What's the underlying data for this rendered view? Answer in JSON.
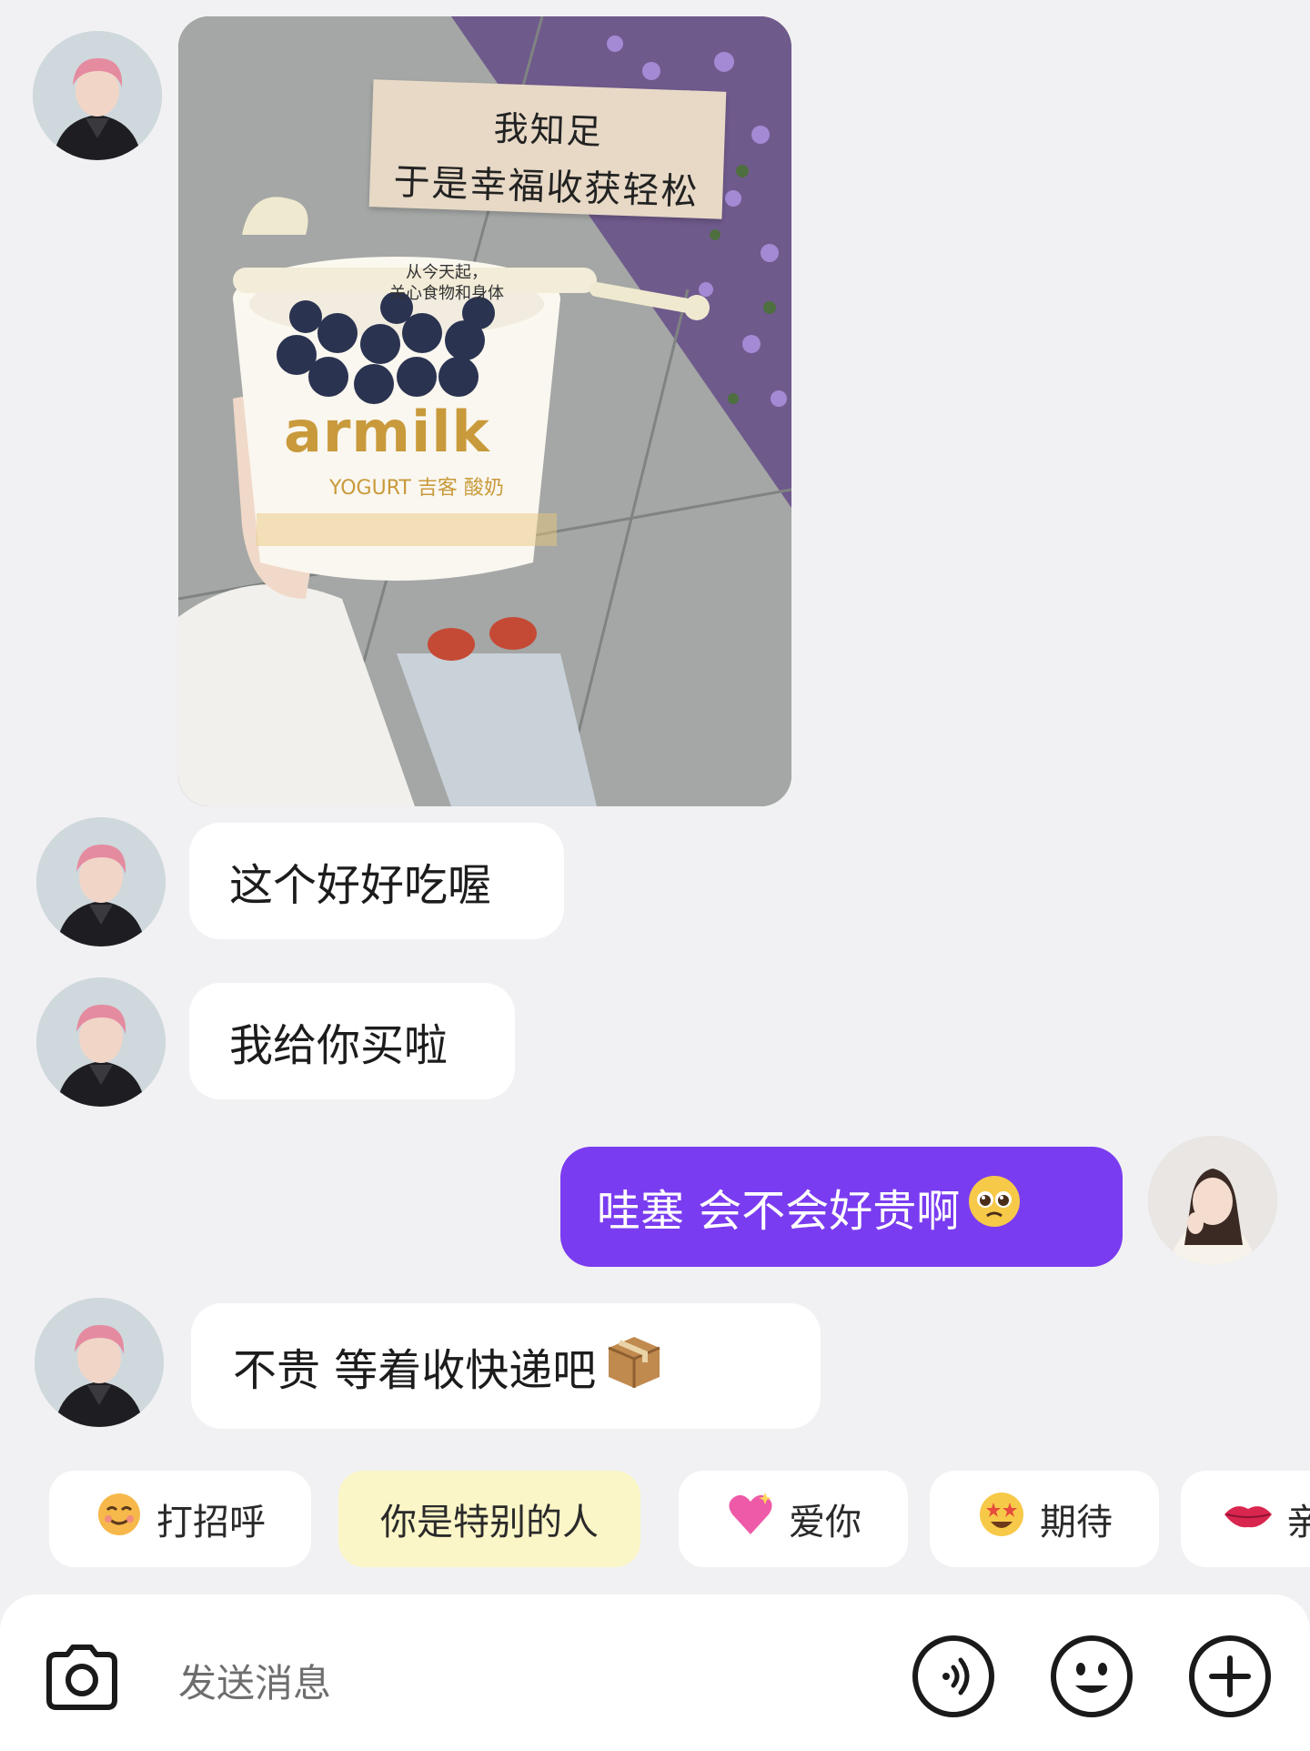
{
  "image_message": {
    "note_line1": "我知足",
    "note_line2": "于是幸福收获轻松",
    "spoon_line1": "从今天起，",
    "spoon_line2": "关心食物和身体",
    "brand": "armilk",
    "brand_sub": "YOGURT 吉客 酸奶"
  },
  "messages": [
    {
      "side": "other",
      "text": "这个好好吃喔"
    },
    {
      "side": "other",
      "text": "我给你买啦"
    },
    {
      "side": "me",
      "text": "哇塞 会不会好贵啊",
      "emoji": "pleading-face-icon"
    },
    {
      "side": "other",
      "text": "不贵 等着收快递吧",
      "emoji": "package-icon"
    }
  ],
  "quick_replies": [
    {
      "label": "打招呼",
      "icon": "smiling-face-icon"
    },
    {
      "label": "你是特别的人",
      "highlighted": true
    },
    {
      "label": "爱你",
      "icon": "sparkling-heart-icon"
    },
    {
      "label": "期待",
      "icon": "star-struck-icon"
    },
    {
      "label": "亲",
      "icon": "lips-icon"
    }
  ],
  "input": {
    "placeholder": "发送消息",
    "icons": [
      "camera-icon",
      "voice-icon",
      "emoji-icon",
      "plus-icon"
    ]
  },
  "colors": {
    "background": "#f1f1f3",
    "my_bubble": "#7a3cf0",
    "other_bubble": "#ffffff",
    "highlight_chip": "#fbf6c7"
  }
}
